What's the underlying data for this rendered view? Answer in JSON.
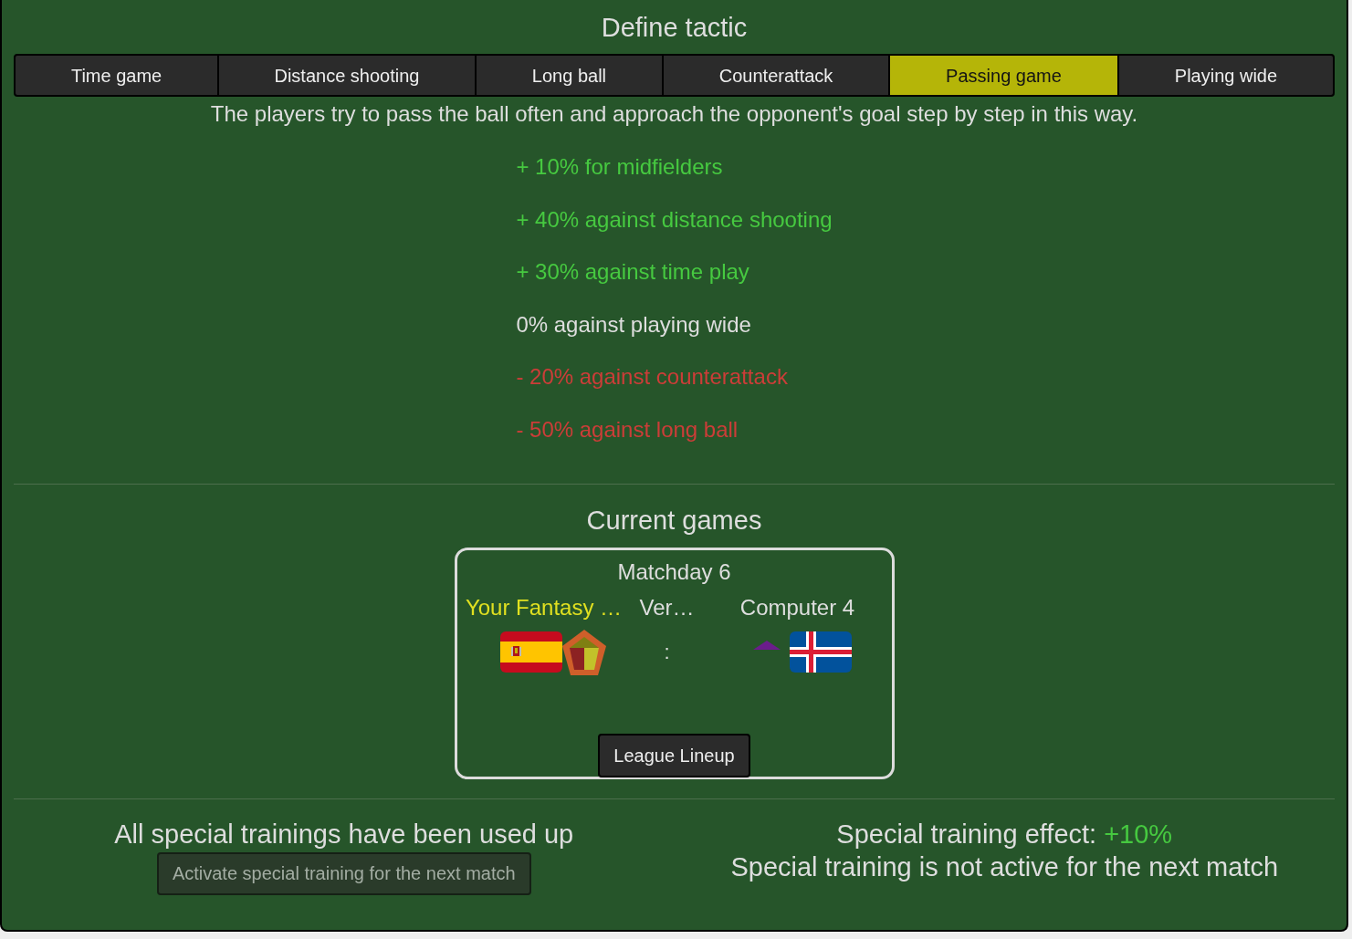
{
  "title": "Define tactic",
  "tabs": [
    {
      "label": "Time game",
      "selected": false
    },
    {
      "label": "Distance shooting",
      "selected": false
    },
    {
      "label": "Long ball",
      "selected": false
    },
    {
      "label": "Counterattack",
      "selected": false
    },
    {
      "label": "Passing game",
      "selected": true
    },
    {
      "label": "Playing wide",
      "selected": false
    }
  ],
  "description": "The players try to pass the ball often and approach the opponent's goal step by step in this way.",
  "effects": [
    {
      "text": "+ 10% for midfielders",
      "kind": "positive"
    },
    {
      "text": "+ 40% against distance shooting",
      "kind": "positive"
    },
    {
      "text": "+ 30% against time play",
      "kind": "positive"
    },
    {
      "text": "0% against playing wide",
      "kind": "neutral"
    },
    {
      "text": "- 20% against counterattack",
      "kind": "negative"
    },
    {
      "text": "- 50% against long ball",
      "kind": "negative"
    }
  ],
  "current_games": {
    "title": "Current games",
    "matches": [
      {
        "matchday": "Matchday 6",
        "home": {
          "name": "Your Fantasy …",
          "highlighted": true
        },
        "middle_text": "Ver…",
        "away": {
          "name": "Computer 4",
          "highlighted": false
        },
        "score_separator": ":",
        "button": "League Lineup"
      }
    ]
  },
  "special_training": {
    "status": "All special trainings have been used up",
    "button": {
      "label": "Activate special training for the next match",
      "disabled": true
    },
    "effect_label": "Special training effect:",
    "effect_value": "+10%",
    "active_note": "Special training is not active for the next match"
  }
}
